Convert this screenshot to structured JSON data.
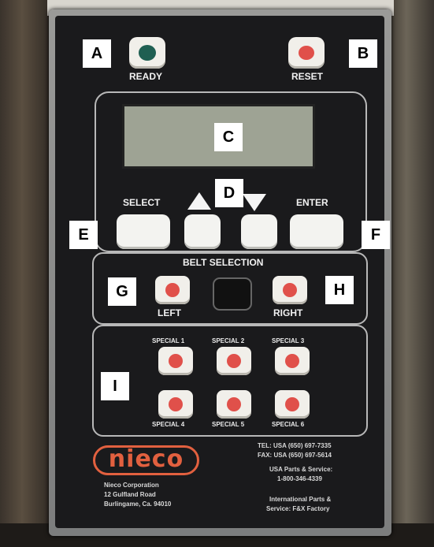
{
  "callouts": {
    "a": "A",
    "b": "B",
    "c": "C",
    "d": "D",
    "e": "E",
    "f": "F",
    "g": "G",
    "h": "H",
    "i": "I"
  },
  "top": {
    "ready_label": "READY",
    "reset_label": "RESET"
  },
  "nav": {
    "select_label": "SELECT",
    "enter_label": "ENTER"
  },
  "belt": {
    "title": "BELT SELECTION",
    "left_label": "LEFT",
    "right_label": "RIGHT"
  },
  "specials": {
    "s1": "SPECIAL 1",
    "s2": "SPECIAL 2",
    "s3": "SPECIAL 3",
    "s4": "SPECIAL 4",
    "s5": "SPECIAL 5",
    "s6": "SPECIAL 6"
  },
  "brand": {
    "logo": "nieco",
    "company_line1": "Nieco Corporation",
    "company_line2": "12 Gulfland Road",
    "company_line3": "Burlingame, Ca. 94010",
    "tel": "TEL: USA (650) 697-7335",
    "fax": "FAX: USA (650) 697-5614",
    "usa_parts1": "USA Parts & Service:",
    "usa_parts2": "1-800-346-4339",
    "intl1": "International Parts &",
    "intl2": "Service: F&X Factory"
  },
  "colors": {
    "indicator_green": "#1f5f52",
    "button_red": "#e0504a",
    "logo_orange": "#e2603f"
  }
}
